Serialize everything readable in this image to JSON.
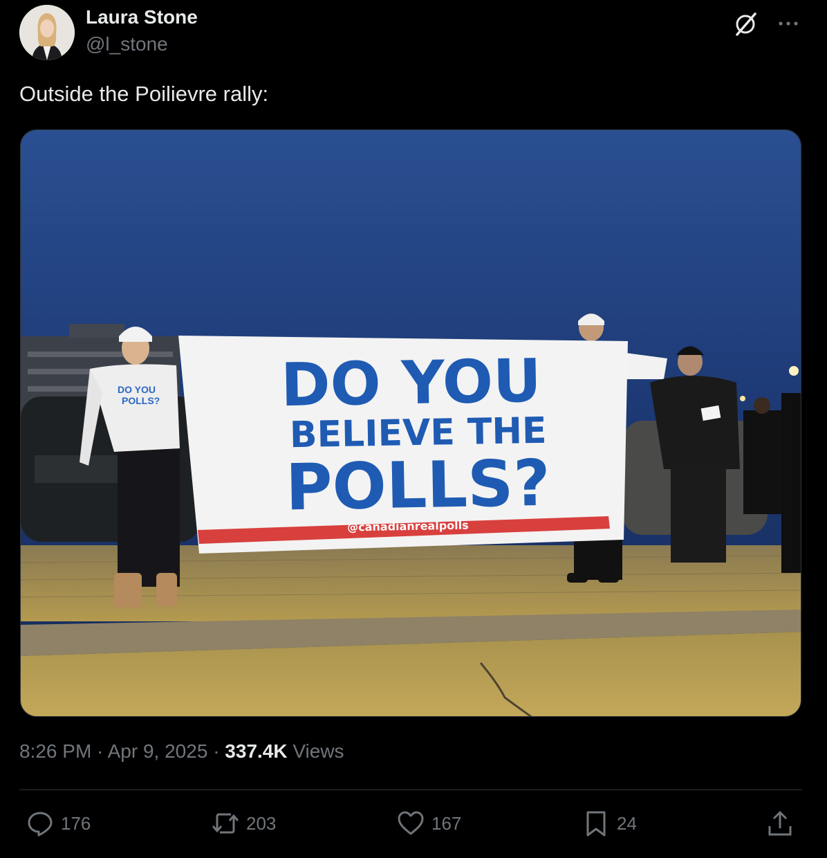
{
  "author": {
    "name": "Laura Stone",
    "handle": "@l_stone"
  },
  "icons": {
    "grok": "grok-icon",
    "more": "more-icon",
    "reply": "reply-icon",
    "repost": "repost-icon",
    "like": "heart-icon",
    "bookmark": "bookmark-icon",
    "share": "share-icon"
  },
  "post": {
    "text": "Outside the Poilievre rally:",
    "time": "8:26 PM",
    "date": "Apr 9, 2025",
    "views_count": "337.4K",
    "views_label": "Views",
    "separator": "·"
  },
  "photo": {
    "banner_line1": "DO YOU",
    "banner_line2": "BELIEVE THE",
    "banner_line3": "POLLS?",
    "banner_handle": "@canadianrealpolls",
    "sweatshirt_text": "DO YOU BELIEVE THE POLLS?"
  },
  "actions": {
    "replies": "176",
    "reposts": "203",
    "likes": "167",
    "bookmarks": "24"
  },
  "colors": {
    "background": "#000000",
    "text_primary": "#e7e9ea",
    "text_secondary": "#71767b",
    "divider": "#2f3336",
    "banner_blue": "#1f5bb3",
    "banner_red": "#d8403e"
  }
}
